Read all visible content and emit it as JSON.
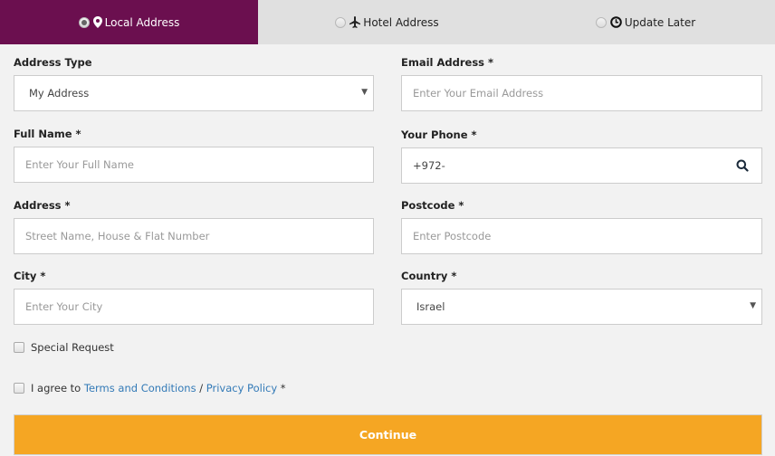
{
  "tabs": [
    {
      "label": "Local Address",
      "icon": "map-marker-icon",
      "selected": true
    },
    {
      "label": "Hotel Address",
      "icon": "airplane-icon",
      "selected": false
    },
    {
      "label": "Update Later",
      "icon": "clock-icon",
      "selected": false
    }
  ],
  "form": {
    "address_type": {
      "label": "Address Type",
      "value": "My Address"
    },
    "email": {
      "label": "Email Address *",
      "placeholder": "Enter Your Email Address"
    },
    "full_name": {
      "label": "Full Name *",
      "placeholder": "Enter Your Full Name"
    },
    "phone": {
      "label": "Your Phone *",
      "value": "+972-"
    },
    "address": {
      "label": "Address *",
      "placeholder": "Street Name, House & Flat Number"
    },
    "postcode": {
      "label": "Postcode *",
      "placeholder": "Enter Postcode"
    },
    "city": {
      "label": "City *",
      "placeholder": "Enter Your City"
    },
    "country": {
      "label": "Country *",
      "value": "Israel"
    }
  },
  "special_request": {
    "label": "Special Request",
    "checked": false
  },
  "agree": {
    "prefix": "I agree to ",
    "terms_link": "Terms and Conditions",
    "separator": " / ",
    "privacy_link": "Privacy Policy",
    "suffix": " *",
    "checked": false
  },
  "continue_label": "Continue",
  "colors": {
    "active_tab": "#6b0f4f",
    "continue_button": "#f5a623",
    "link": "#337ab7"
  }
}
